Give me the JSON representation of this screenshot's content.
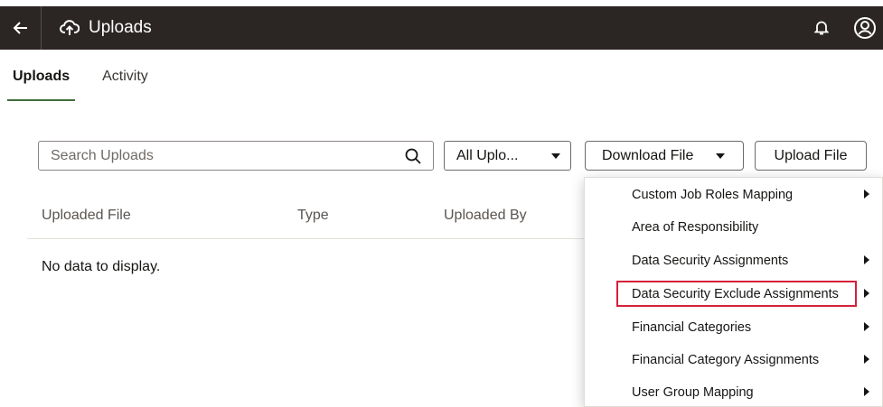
{
  "header": {
    "title": "Uploads",
    "back_icon": "arrow-left-icon",
    "app_icon": "cloud-upload-icon",
    "notification_icon": "bell-icon",
    "profile_icon": "user-avatar-icon"
  },
  "tabs": [
    {
      "label": "Uploads",
      "active": true
    },
    {
      "label": "Activity",
      "active": false
    }
  ],
  "toolbar": {
    "search_placeholder": "Search Uploads",
    "filter_value": "All Uplo...",
    "download_label": "Download File",
    "upload_label": "Upload File"
  },
  "table": {
    "columns": [
      "Uploaded File",
      "Type",
      "Uploaded By"
    ],
    "empty_text": "No data to display."
  },
  "download_menu": {
    "items": [
      {
        "label": "Custom Job Roles Mapping",
        "has_submenu": true
      },
      {
        "label": "Area of Responsibility",
        "has_submenu": false
      },
      {
        "label": "Data Security Assignments",
        "has_submenu": true
      },
      {
        "label": "Data Security Exclude Assignments",
        "has_submenu": true,
        "highlighted": true
      },
      {
        "label": "Financial Categories",
        "has_submenu": true
      },
      {
        "label": "Financial Category Assignments",
        "has_submenu": true
      },
      {
        "label": "User Group Mapping",
        "has_submenu": true
      }
    ],
    "highlight_color": "#d6203a"
  },
  "colors": {
    "header_bg": "#2b2624",
    "active_tab_underline": "#3f6e3a"
  }
}
